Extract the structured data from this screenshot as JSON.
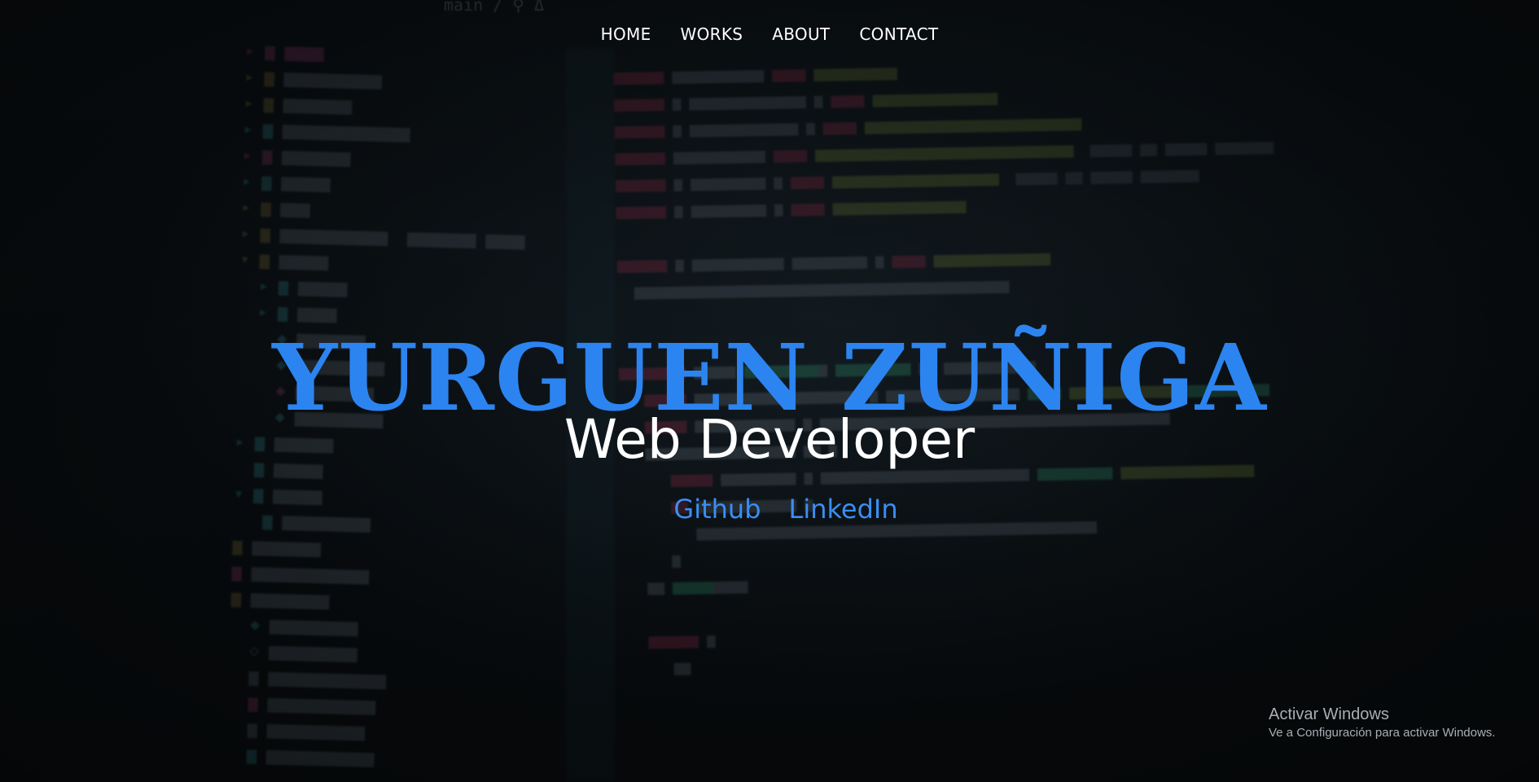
{
  "nav": {
    "items": [
      {
        "label": "HOME"
      },
      {
        "label": "WORKS"
      },
      {
        "label": "ABOUT"
      },
      {
        "label": "CONTACT"
      }
    ]
  },
  "hero": {
    "name": "YURGUEN ZUÑIGA",
    "role": "Web Developer",
    "links": [
      {
        "label": "Github"
      },
      {
        "label": "LinkedIn"
      }
    ]
  },
  "watermark": {
    "title": "Activar Windows",
    "subtitle": "Ve a Configuración para activar Windows."
  },
  "colors": {
    "name_accent": "#2c84f0",
    "link_accent": "#3a8ef5",
    "background": "#0b0f12"
  }
}
